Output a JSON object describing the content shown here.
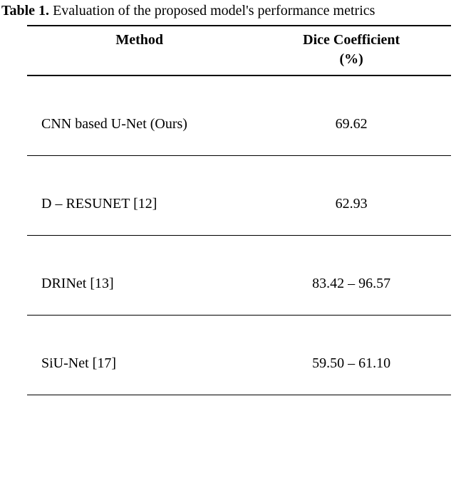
{
  "caption": {
    "label": "Table 1.",
    "text": " Evaluation of the proposed model's performance metrics"
  },
  "table": {
    "headers": {
      "method": "Method",
      "dice_line1": "Dice Coefficient",
      "dice_line2": "(%)"
    },
    "rows": [
      {
        "method": "CNN based U-Net (Ours)",
        "value": "69.62"
      },
      {
        "method": "D – RESUNET [12]",
        "value": "62.93"
      },
      {
        "method": "DRINet [13]",
        "value": "83.42 – 96.57"
      },
      {
        "method": "SiU-Net [17]",
        "value": "59.50 – 61.10"
      }
    ]
  },
  "chart_data": {
    "type": "table",
    "title": "Evaluation of the proposed model's performance metrics",
    "columns": [
      "Method",
      "Dice Coefficient (%)"
    ],
    "rows": [
      [
        "CNN based U-Net (Ours)",
        "69.62"
      ],
      [
        "D – RESUNET [12]",
        "62.93"
      ],
      [
        "DRINet [13]",
        "83.42 – 96.57"
      ],
      [
        "SiU-Net [17]",
        "59.50 – 61.10"
      ]
    ]
  }
}
